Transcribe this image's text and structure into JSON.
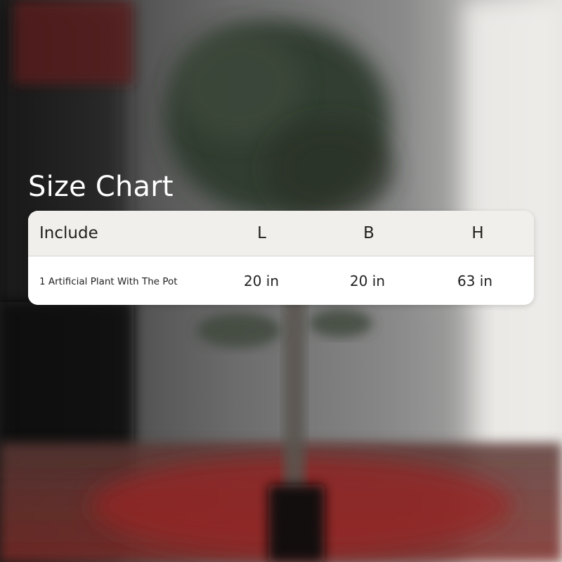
{
  "title": "Size Chart",
  "table": {
    "headers": {
      "include": "Include",
      "l": "L",
      "b": "B",
      "h": "H"
    },
    "rows": [
      {
        "include": "1 Artificial Plant With The Pot",
        "l": "20 in",
        "b": "20 in",
        "h": "63 in"
      }
    ]
  },
  "colors": {
    "title_text": "#ffffff",
    "header_bg": "#f0efeb",
    "row_bg": "#ffffff",
    "text": "#1f1f1f"
  }
}
